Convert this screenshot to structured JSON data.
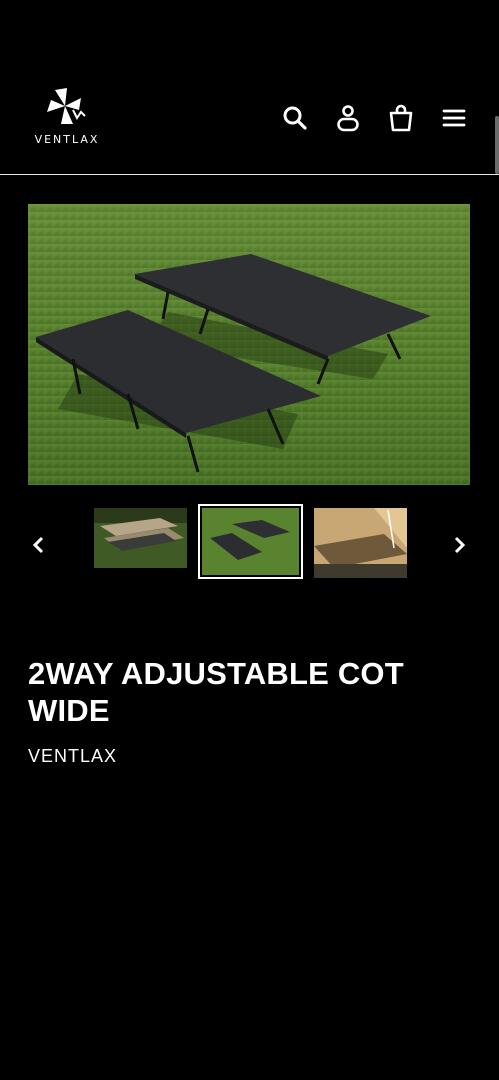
{
  "header": {
    "logo_text": "VENTLAX",
    "icons": [
      "search-icon",
      "account-icon",
      "cart-icon",
      "menu-icon"
    ]
  },
  "product": {
    "title": "2WAY ADJUSTABLE COT WIDE",
    "vendor": "VENTLAX"
  },
  "gallery": {
    "thumbnails": [
      "thumb-1",
      "thumb-2",
      "thumb-3"
    ],
    "active_index": 1,
    "prev_icon": "chevron-left-icon",
    "next_icon": "chevron-right-icon"
  },
  "colors": {
    "background": "#000000",
    "text": "#ffffff",
    "grass": "#4f7a2a",
    "cot": "#2b2d30"
  }
}
